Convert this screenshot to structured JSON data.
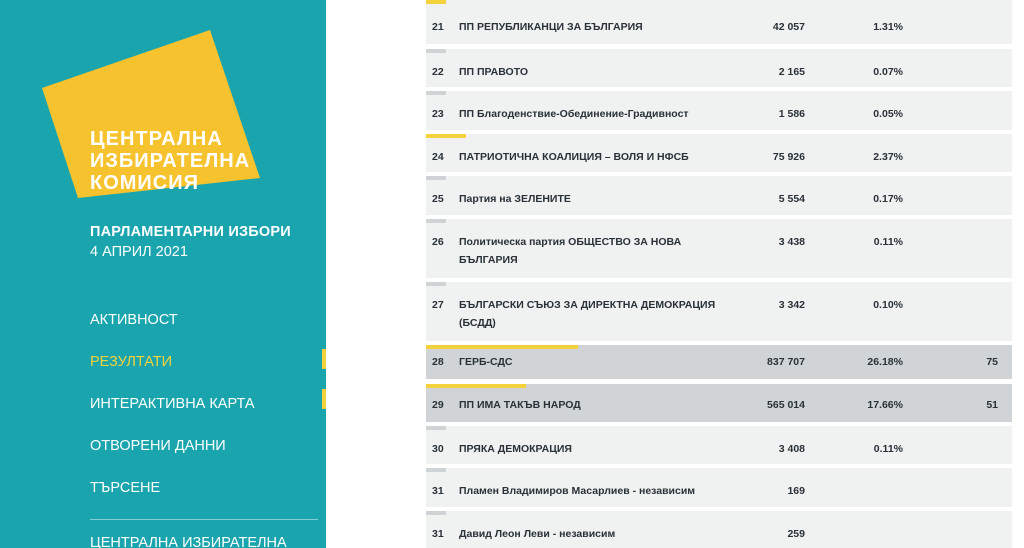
{
  "sidebar": {
    "logo_lines": [
      "ЦЕНТРАЛНА",
      "ИЗБИРАТЕЛНА",
      "КОМИСИЯ"
    ],
    "election_title": "ПАРЛАМЕНТАРНИ ИЗБОРИ",
    "election_date": "4 АПРИЛ 2021",
    "nav": [
      {
        "label": "АКТИВНОСТ",
        "active": false
      },
      {
        "label": "РЕЗУЛТАТИ",
        "active": true
      },
      {
        "label": "ИНТЕРАКТИВНА КАРТА",
        "active": false
      },
      {
        "label": "ОТВОРЕНИ ДАННИ",
        "active": false
      },
      {
        "label": "ТЪРСЕНЕ",
        "active": false
      }
    ],
    "footer_link": "ЦЕНТРАЛНА ИЗБИРАТЕЛНА",
    "colors": {
      "background": "#1aa4ad",
      "accent": "#f3d23c",
      "logo": "#f6c22e"
    }
  },
  "results": {
    "rows": [
      {
        "num": "21",
        "name": "ПП РЕПУБЛИКАНЦИ ЗА БЪЛГАРИЯ",
        "votes": "42 057",
        "pct": "1.31%",
        "seats": ""
      },
      {
        "num": "22",
        "name": "ПП ПРАВОТО",
        "votes": "2 165",
        "pct": "0.07%",
        "seats": ""
      },
      {
        "num": "23",
        "name": "ПП Благоденствие-Обединение-Градивност",
        "votes": "1 586",
        "pct": "0.05%",
        "seats": ""
      },
      {
        "num": "24",
        "name": "ПАТРИОТИЧНА КОАЛИЦИЯ – ВОЛЯ И НФСБ",
        "votes": "75 926",
        "pct": "2.37%",
        "seats": ""
      },
      {
        "num": "25",
        "name": "Партия на ЗЕЛЕНИТЕ",
        "votes": "5 554",
        "pct": "0.17%",
        "seats": ""
      },
      {
        "num": "26",
        "name": "Политическа партия  ОБЩЕСТВО ЗА НОВА БЪЛГАРИЯ",
        "votes": "3 438",
        "pct": "0.11%",
        "seats": ""
      },
      {
        "num": "27",
        "name": "БЪЛГАРСКИ СЪЮЗ ЗА ДИРЕКТНА ДЕМОКРАЦИЯ (БСДД)",
        "votes": "3 342",
        "pct": "0.10%",
        "seats": ""
      },
      {
        "num": "28",
        "name": "ГЕРБ-СДС",
        "votes": "837 707",
        "pct": "26.18%",
        "seats": "75"
      },
      {
        "num": "29",
        "name": "ПП ИМА ТАКЪВ НАРОД",
        "votes": "565 014",
        "pct": "17.66%",
        "seats": "51"
      },
      {
        "num": "30",
        "name": "ПРЯКА ДЕМОКРАЦИЯ",
        "votes": "3 408",
        "pct": "0.11%",
        "seats": ""
      },
      {
        "num": "31",
        "name": "Пламен Владимиров Масарлиев - независим",
        "votes": "169",
        "pct": "",
        "seats": ""
      },
      {
        "num": "31",
        "name": "Давид Леон Леви - независим",
        "votes": "259",
        "pct": "",
        "seats": ""
      }
    ]
  }
}
